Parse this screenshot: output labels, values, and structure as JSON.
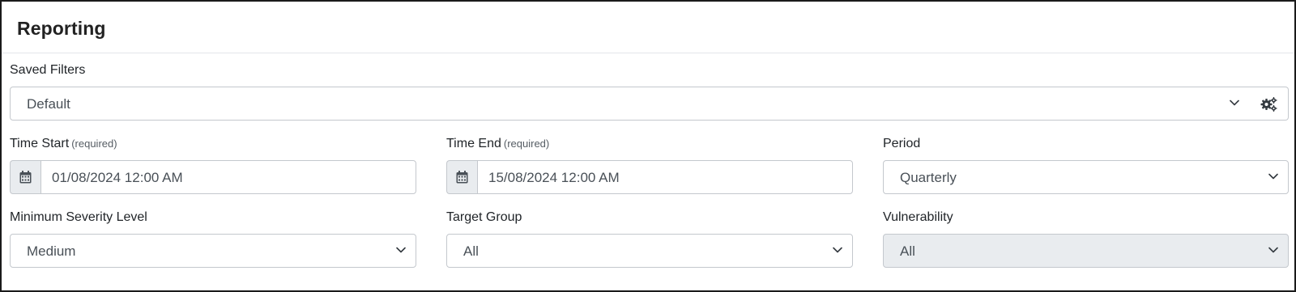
{
  "header": {
    "title": "Reporting"
  },
  "saved_filters": {
    "label": "Saved Filters",
    "value": "Default",
    "settings_icon": "gears-icon"
  },
  "time_start": {
    "label": "Time Start",
    "required": "(required)",
    "value": "01/08/2024 12:00 AM",
    "icon": "calendar-icon"
  },
  "time_end": {
    "label": "Time End",
    "required": "(required)",
    "value": "15/08/2024 12:00 AM",
    "icon": "calendar-icon"
  },
  "period": {
    "label": "Period",
    "value": "Quarterly"
  },
  "severity": {
    "label": "Minimum Severity Level",
    "value": "Medium"
  },
  "target_group": {
    "label": "Target Group",
    "value": "All"
  },
  "vulnerability": {
    "label": "Vulnerability",
    "value": "All",
    "disabled": true
  },
  "colors": {
    "border": "#c4c8cd",
    "disabled_bg": "#e9ecef",
    "frame": "#1a1a1a"
  }
}
